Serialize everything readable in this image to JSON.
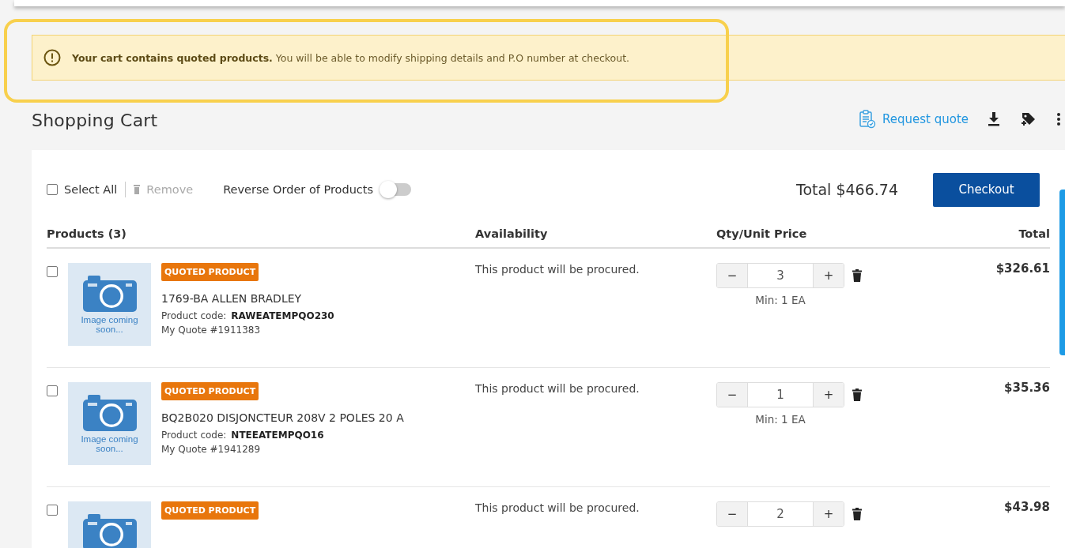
{
  "alert": {
    "text": "**Your cart contains quoted products.** You will be able to modify shipping details and P.O number at checkout."
  },
  "header": {
    "title": "Shopping Cart",
    "request_quote": "Request quote"
  },
  "toolbar": {
    "select_all": {
      "label": "Select All",
      "checked": false
    },
    "remove": {
      "label": "Remove",
      "disabled": true
    },
    "reverse": {
      "label": "Reverse Order of Products",
      "on": false
    },
    "total": "Total $466.74",
    "checkout": "Checkout"
  },
  "table": {
    "columns": [
      "Products (3)",
      "Availability",
      "Qty/Unit Price",
      "Total"
    ],
    "rows": [
      {
        "checked": false,
        "badge": "QUOTED PRODUCT",
        "image_text": "Image coming soon...",
        "name": "1769-BA ALLEN BRADLEY",
        "code_label": "Product code:",
        "code": "RAWEATEMPQO230",
        "quote": "My Quote #1911383",
        "availability": "This product will be procured.",
        "minus": "−",
        "qty": "3",
        "plus": "+",
        "min": "Min: 1 EA",
        "total": "$326.61"
      },
      {
        "checked": false,
        "badge": "QUOTED PRODUCT",
        "image_text": "Image coming soon...",
        "name": "BQ2B020 DISJONCTEUR 208V 2 POLES 20 A",
        "code_label": "Product code:",
        "code": "NTEEATEMPQO16",
        "quote": "My Quote #1941289",
        "availability": "This product will be procured.",
        "minus": "−",
        "qty": "1",
        "plus": "+",
        "min": "Min: 1 EA",
        "total": "$35.36"
      },
      {
        "checked": false,
        "badge": "QUOTED PRODUCT",
        "availability": "This product will be procured.",
        "minus": "−",
        "qty": "2",
        "plus": "+",
        "total": "$43.98"
      }
    ]
  }
}
